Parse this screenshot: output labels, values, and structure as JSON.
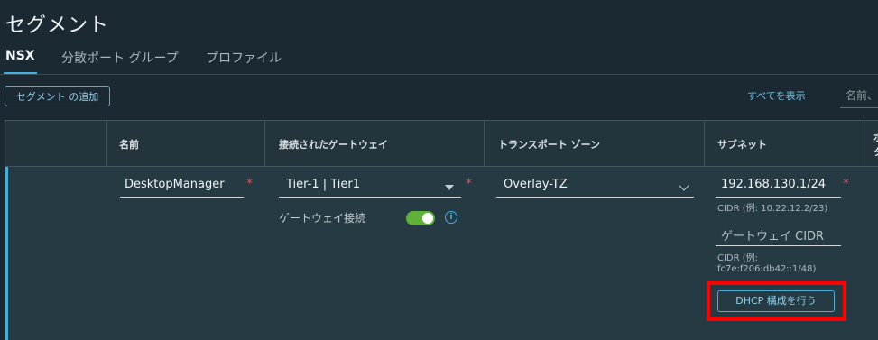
{
  "page": {
    "title": "セグメント"
  },
  "tabs": [
    {
      "label": "NSX",
      "active": true
    },
    {
      "label": "分散ポート グループ",
      "active": false
    },
    {
      "label": "プロファイル",
      "active": false
    }
  ],
  "toolbar": {
    "add_label": "セグメント の追加",
    "show_all": "すべてを表示",
    "search_placeholder": "名前、"
  },
  "table": {
    "columns": [
      "名前",
      "接続されたゲートウェイ",
      "トランスポート ゾーン",
      "サブネット",
      "ポ",
      "タ"
    ],
    "row": {
      "name": "DesktopManager",
      "gateway": "Tier-1 | Tier1",
      "gateway_connect_label": "ゲートウェイ接続",
      "gateway_connect_on": true,
      "transport_zone": "Overlay-TZ",
      "subnet": "192.168.130.1/24",
      "subnet_hint": "CIDR (例: 10.22.12.2/23)",
      "gateway_cidr_placeholder": "ゲートウェイ CIDR",
      "gateway_cidr_hint_line1": "CIDR (例:",
      "gateway_cidr_hint_line2": "fc7e:f206:db42::1/48)",
      "dhcp_label": "DHCP 構成を行う",
      "required_mark": "*",
      "info_mark": "i"
    }
  },
  "colors": {
    "accent": "#49afd9",
    "toggle_on": "#5fb13c",
    "required": "#e0524a",
    "highlight": "#ff0000"
  }
}
